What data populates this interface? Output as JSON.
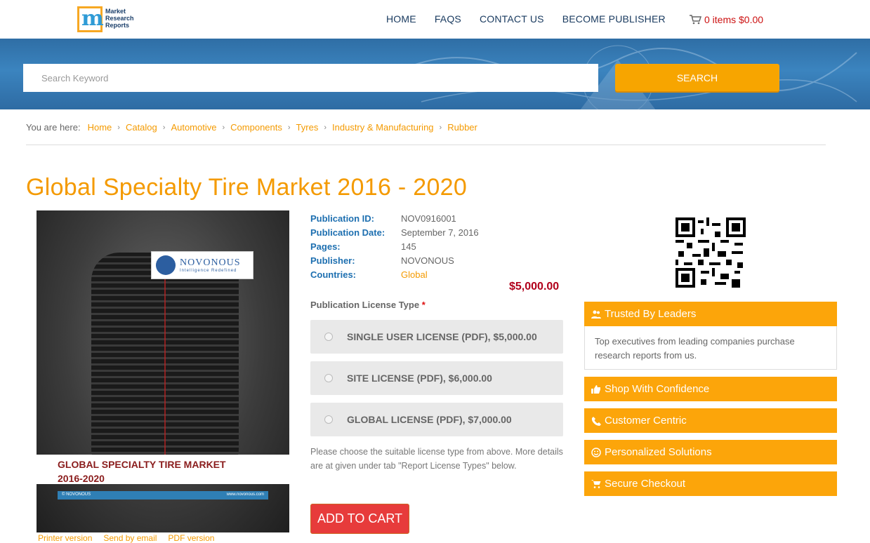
{
  "header": {
    "logo_text": "Market Research Reports",
    "logo_letter": "m",
    "nav": [
      "HOME",
      "FAQS",
      "CONTACT US",
      "BECOME PUBLISHER"
    ],
    "cart": "0 items $0.00"
  },
  "search": {
    "placeholder": "Search Keyword",
    "button": "SEARCH"
  },
  "breadcrumb": {
    "label": "You are here:",
    "items": [
      "Home",
      "Catalog",
      "Automotive",
      "Components",
      "Tyres",
      "Industry & Manufacturing",
      "Rubber"
    ]
  },
  "page_title": "Global Specialty Tire Market 2016 - 2020",
  "cover": {
    "publisher_badge": "NOVONOUS",
    "tagline": "Intelligence Redefined",
    "line1": "GLOBAL SPECIALTY TIRE MARKET",
    "line2": "2016-2020",
    "strip_left": "© NOVONOUS",
    "strip_right": "www.novonous.com"
  },
  "meta": [
    {
      "k": "Publication ID:",
      "v": "NOV0916001"
    },
    {
      "k": "Publication Date:",
      "v": "September 7, 2016"
    },
    {
      "k": "Pages:",
      "v": "145"
    },
    {
      "k": "Publisher:",
      "v": "NOVONOUS"
    },
    {
      "k": "Countries:",
      "v": "Global"
    }
  ],
  "price": "$5,000.00",
  "license_label": "Publication License Type",
  "licenses": [
    "SINGLE USER LICENSE (PDF), $5,000.00",
    "SITE LICENSE (PDF), $6,000.00",
    "GLOBAL LICENSE (PDF), $7,000.00"
  ],
  "license_note": "Please choose the suitable license type from above. More details are at given under tab \"Report License Types\" below.",
  "add_to_cart": "ADD TO CART",
  "bottom_links": [
    "Printer version",
    "Send by email",
    "PDF version"
  ],
  "sidebar": {
    "trusted_title": "Trusted By Leaders",
    "trusted_body": "Top executives from leading companies purchase research reports from us.",
    "items": [
      "Shop With Confidence",
      "Customer Centric",
      "Personalized Solutions",
      "Secure Checkout"
    ]
  },
  "colors": {
    "accent": "#f49a00",
    "hero": "#3b84bf",
    "price": "#b1001b",
    "cart_button": "#e73b3b"
  }
}
